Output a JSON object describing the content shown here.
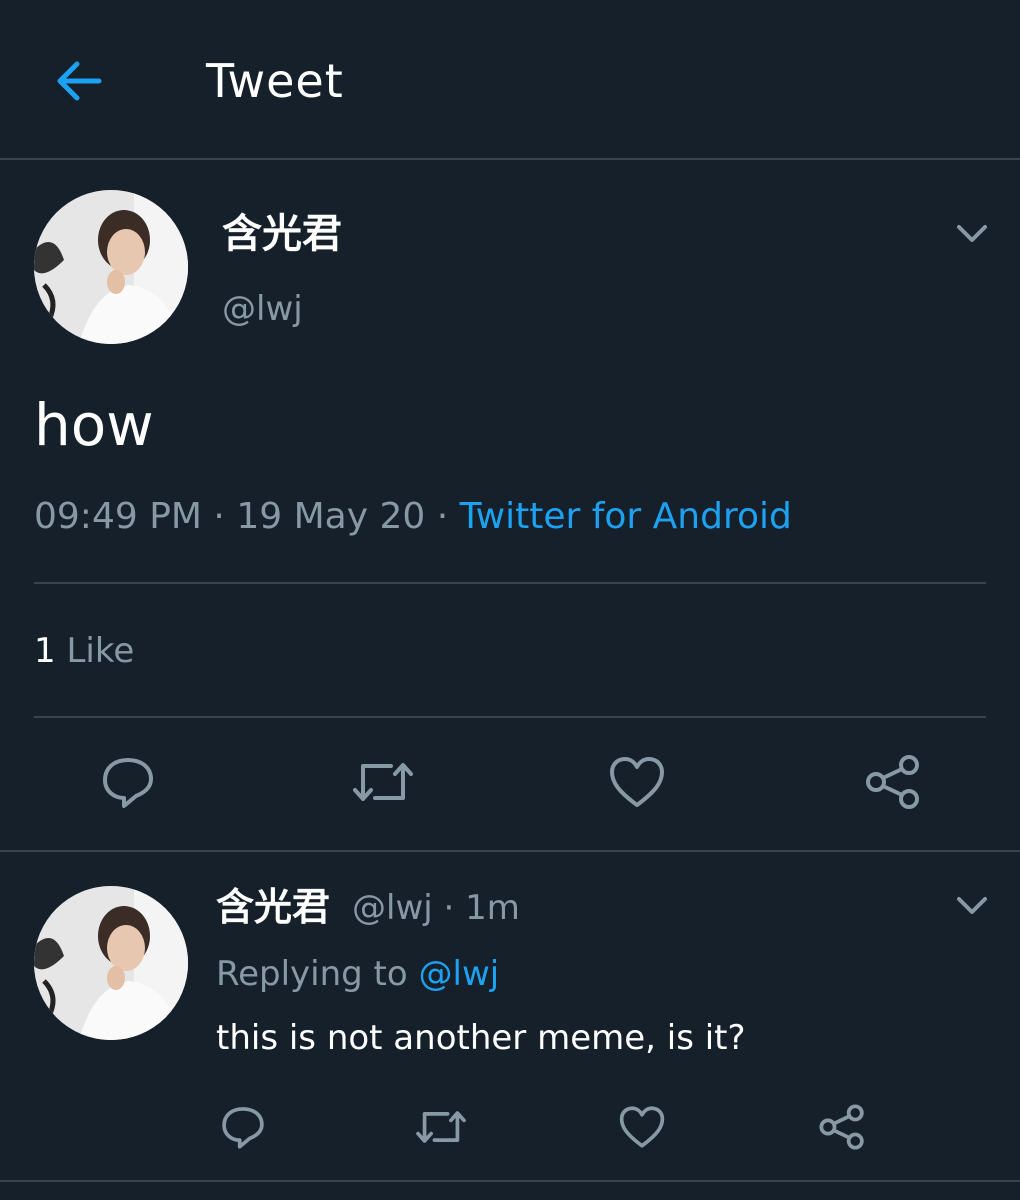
{
  "header": {
    "title": "Tweet",
    "back_icon": "arrow-left-icon"
  },
  "colors": {
    "background": "#15202b",
    "divider": "#38444d",
    "accent": "#1da1f2",
    "secondary_text": "#8899a6",
    "primary_text": "#ffffff"
  },
  "main_tweet": {
    "display_name": "含光君",
    "handle": "@lwj",
    "text": "how",
    "time": "09:49 PM",
    "separator": "·",
    "date": "19 May 20",
    "source": "Twitter for Android",
    "like_count": "1",
    "like_label": "Like",
    "actions": [
      "reply-icon",
      "retweet-icon",
      "like-icon",
      "share-icon"
    ]
  },
  "reply_tweet": {
    "display_name": "含光君",
    "handle": "@lwj",
    "separator": "·",
    "age": "1m",
    "replying_label": "Replying to",
    "replying_to": "@lwj",
    "text": "this is not another meme, is it?",
    "actions": [
      "reply-icon",
      "retweet-icon",
      "like-icon",
      "share-icon"
    ]
  }
}
